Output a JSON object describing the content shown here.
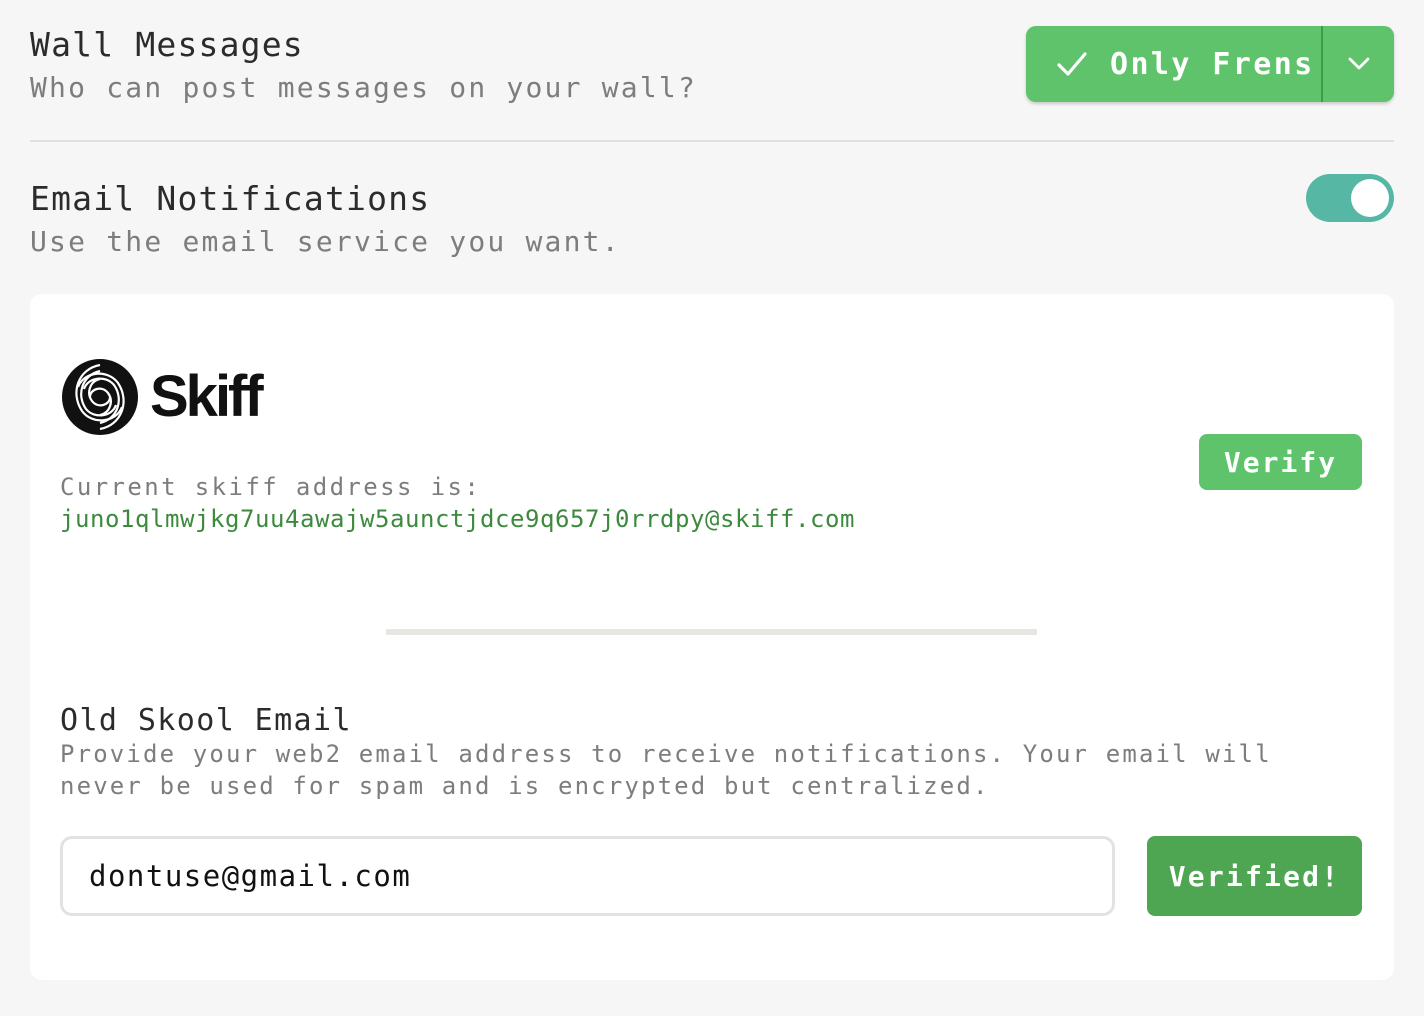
{
  "wall_messages": {
    "title": "Wall Messages",
    "subtitle": "Who can post messages on your wall?",
    "dropdown": {
      "selected_label": "Only Frens",
      "check_icon": "check-icon",
      "caret_icon": "chevron-down-icon"
    }
  },
  "email_notifications": {
    "title": "Email Notifications",
    "subtitle": "Use the email service you want.",
    "toggle_on": true
  },
  "skiff": {
    "brand": "Skiff",
    "address_label": "Current skiff address is:",
    "address": "juno1qlmwjkg7uu4awajw5aunctjdce9q657j0rrdpy@skiff.com",
    "verify_label": "Verify"
  },
  "old_skool": {
    "title": "Old Skool Email",
    "description": "Provide your web2 email address to receive notifications. Your email will never be used for spam and is encrypted but centralized.",
    "email_value": "dontuse@gmail.com",
    "verified_label": "Verified!"
  },
  "colors": {
    "green": "#5ec36b",
    "dark_green": "#4ea552",
    "teal": "#56b7a5",
    "address_green": "#3d8a3f"
  }
}
